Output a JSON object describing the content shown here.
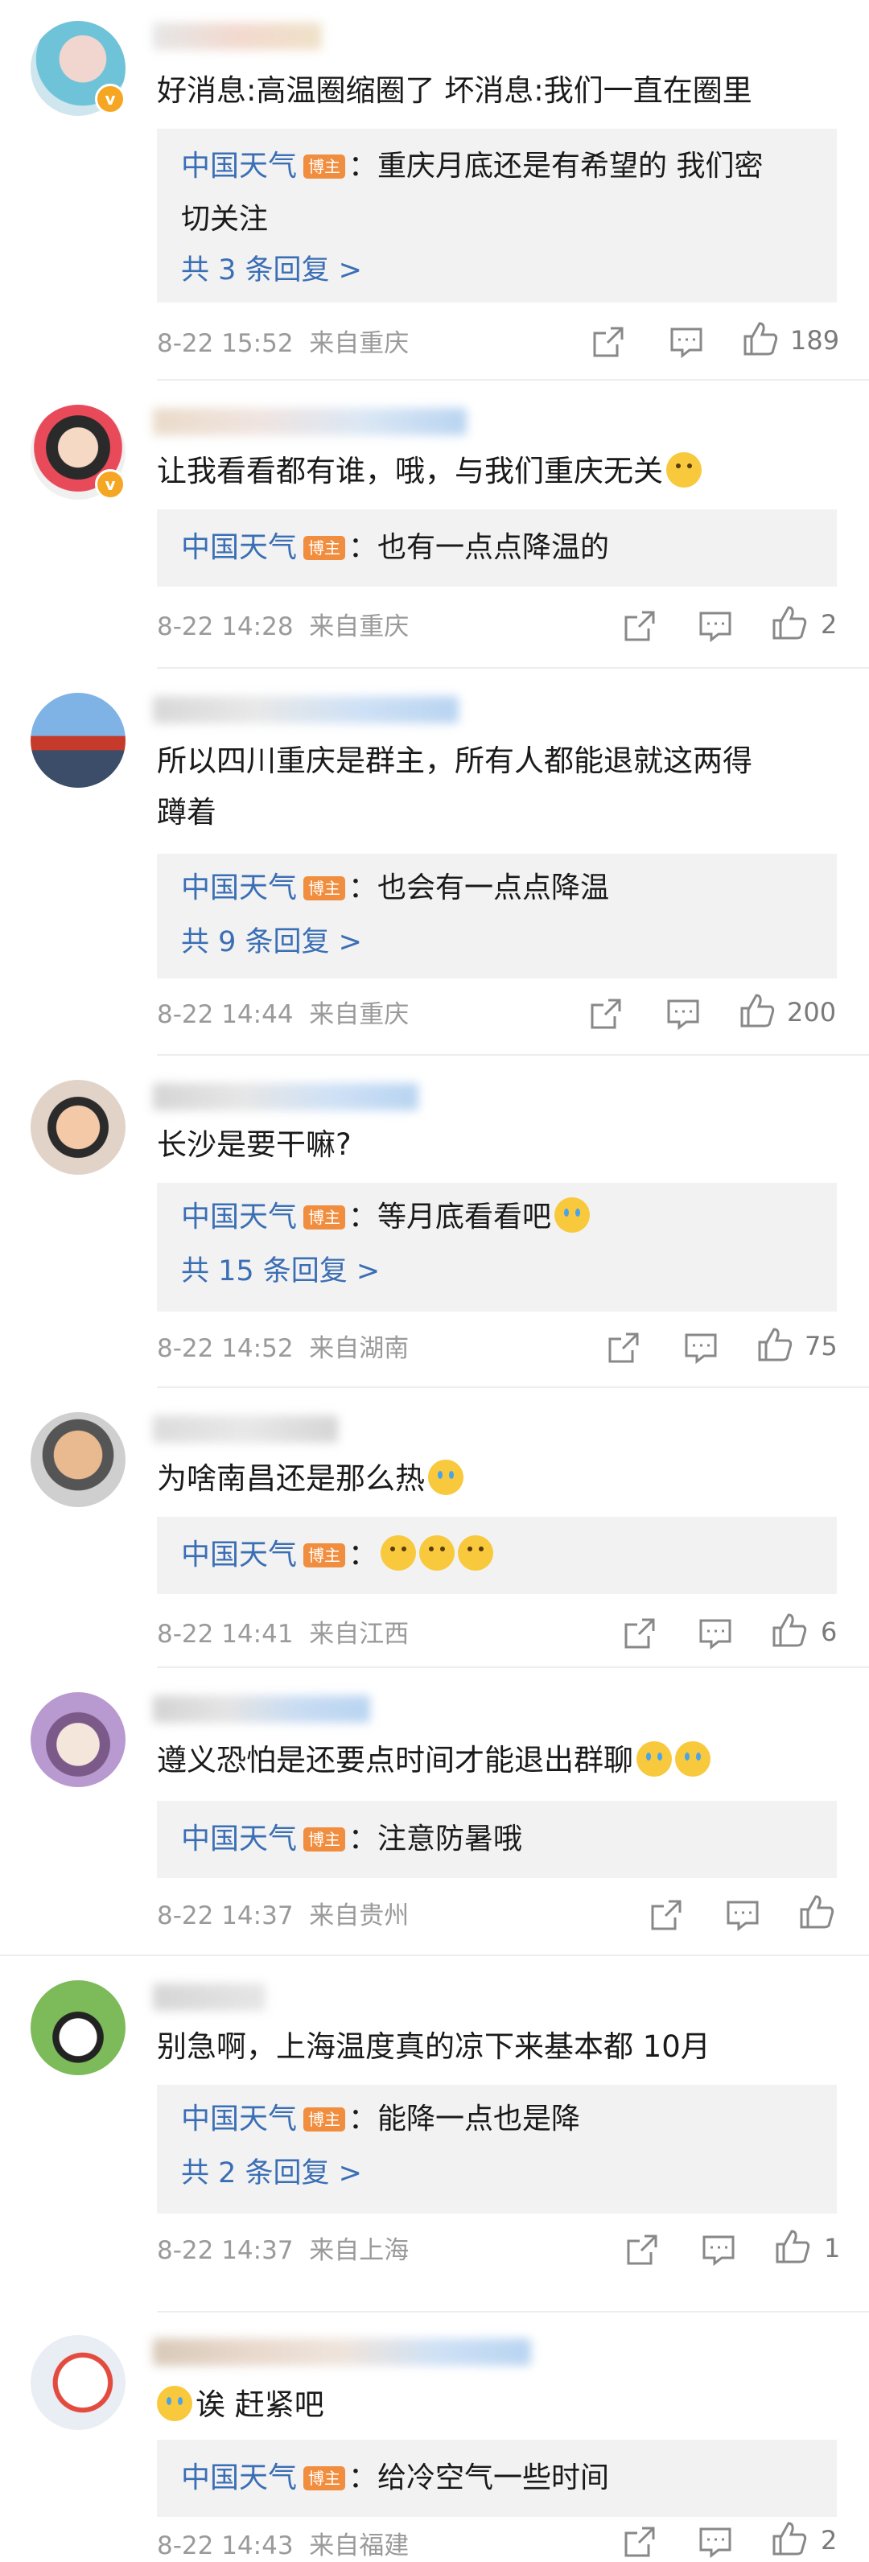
{
  "reply_tag": "博主",
  "reply_author": "中国天气",
  "comments": [
    {
      "text": "好消息:高温圈缩圈了 坏消息:我们一直在圈里",
      "reply_text": "：重庆月底还是有希望的 我们密",
      "reply_text2": "切关注",
      "more": "共 3 条回复 >",
      "date": "8-22 15:52",
      "location": "来自重庆",
      "likes": "189"
    },
    {
      "text": "让我看看都有谁，哦，与我们重庆无关",
      "reply_text": "：也有一点点降温的",
      "date": "8-22 14:28",
      "location": "来自重庆",
      "likes": "2"
    },
    {
      "text": "所以四川重庆是群主，所有人都能退就这两得",
      "text2": "蹲着",
      "reply_text": "：也会有一点点降温",
      "more": "共 9 条回复 >",
      "date": "8-22 14:44",
      "location": "来自重庆",
      "likes": "200"
    },
    {
      "text": "长沙是要干嘛?",
      "reply_text": "：等月底看看吧",
      "more": "共 15 条回复 >",
      "date": "8-22 14:52",
      "location": "来自湖南",
      "likes": "75"
    },
    {
      "text": "为啥南昌还是那么热",
      "reply_text": "：",
      "date": "8-22 14:41",
      "location": "来自江西",
      "likes": "6"
    },
    {
      "text": "遵义恐怕是还要点时间才能退出群聊",
      "reply_text": "：注意防暑哦",
      "date": "8-22 14:37",
      "location": "来自贵州",
      "likes": ""
    },
    {
      "text": "别急啊，上海温度真的凉下来基本都 10月",
      "reply_text": "：能降一点也是降",
      "more": "共 2 条回复 >",
      "date": "8-22 14:37",
      "location": "来自上海",
      "likes": "1"
    },
    {
      "text": "诶 赶紧吧",
      "reply_text": "：给冷空气一些时间",
      "date": "8-22 14:43",
      "location": "来自福建",
      "likes": "2"
    }
  ],
  "icons": {
    "share": "share-icon",
    "comment": "comment-icon",
    "like": "thumbs-up-icon",
    "verified": "verified-badge-icon"
  }
}
